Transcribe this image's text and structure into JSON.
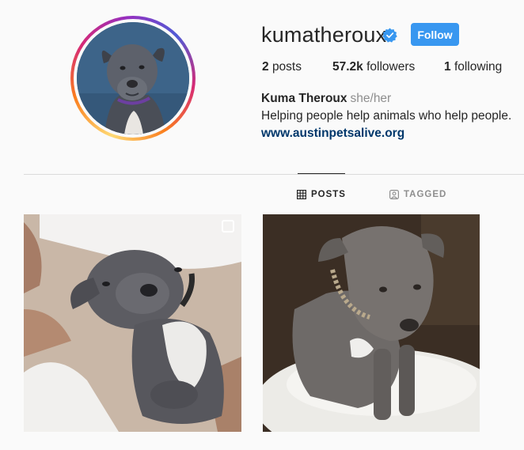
{
  "profile": {
    "username": "kumatheroux",
    "verified": true,
    "follow_label": "Follow",
    "avatar_alt": "profile photo"
  },
  "stats": {
    "posts_count": "2",
    "posts_label": "posts",
    "followers_count": "57.2k",
    "followers_label": "followers",
    "following_count": "1",
    "following_label": "following"
  },
  "bio": {
    "name": "Kuma Theroux",
    "pronouns": "she/her",
    "text": "Helping people help animals who help people.",
    "link": "www.austinpetsalive.org"
  },
  "tabs": [
    {
      "label": "POSTS",
      "icon": "grid-icon",
      "active": true
    },
    {
      "label": "TAGGED",
      "icon": "tag-person-icon",
      "active": false
    }
  ],
  "posts": [
    {
      "subject": "grey pit bull lying on back on pillow",
      "icon": "multiple-photos-icon"
    },
    {
      "subject": "grey pit bull sitting on dog bed"
    }
  ],
  "colors": {
    "follow_button": "#3897f0",
    "link": "#00376b",
    "verified_badge": "#3897f0",
    "muted_text": "#8e8e8e"
  }
}
